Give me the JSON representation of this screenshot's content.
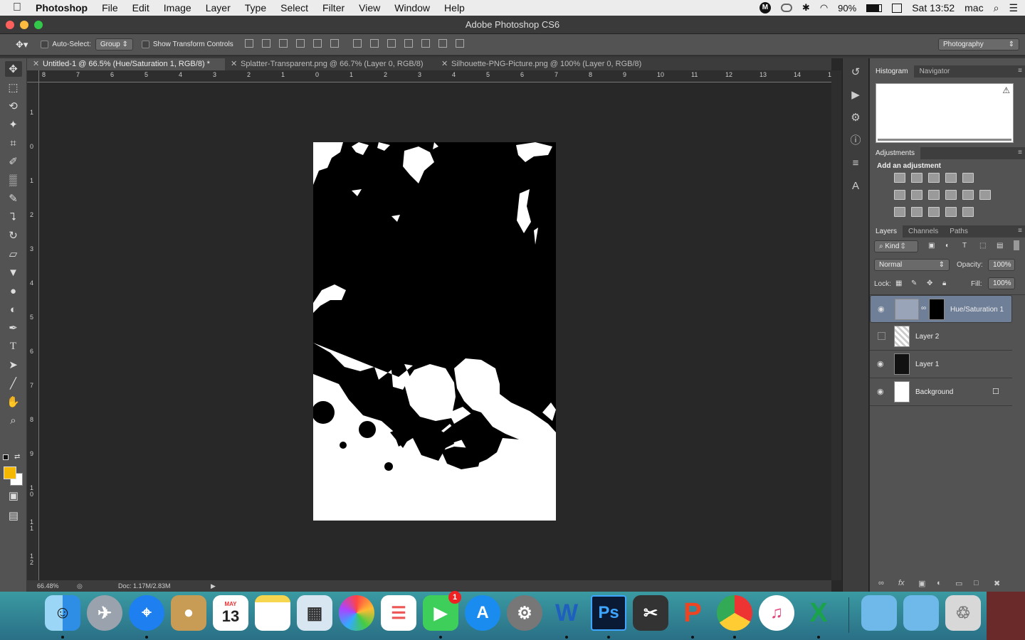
{
  "menubar": {
    "app_name": "Photoshop",
    "items": [
      "File",
      "Edit",
      "Image",
      "Layer",
      "Type",
      "Select",
      "Filter",
      "View",
      "Window",
      "Help"
    ],
    "battery": "90%",
    "clock": "Sat 13:52",
    "user": "mac"
  },
  "window": {
    "title": "Adobe Photoshop CS6"
  },
  "options": {
    "auto_select_label": "Auto-Select:",
    "auto_select_value": "Group",
    "show_transform_label": "Show Transform Controls",
    "workspace": "Photography"
  },
  "tabs": [
    {
      "label": "Untitled-1 @ 66.5% (Hue/Saturation 1, RGB/8) *"
    },
    {
      "label": "Splatter-Transparent.png @ 66.7% (Layer 0, RGB/8)"
    },
    {
      "label": "Silhouette-PNG-Picture.png @ 100% (Layer 0, RGB/8)"
    }
  ],
  "hruler_labels": [
    "8",
    "7",
    "6",
    "5",
    "4",
    "3",
    "2",
    "1",
    "0",
    "1",
    "2",
    "3",
    "4",
    "5",
    "6",
    "7",
    "8",
    "9",
    "10",
    "11",
    "12",
    "13",
    "14",
    "1"
  ],
  "vruler_labels": [
    "1",
    "0",
    "1",
    "2",
    "3",
    "4",
    "5",
    "6",
    "7",
    "8",
    "9",
    "1 0",
    "1 1",
    "1 2"
  ],
  "status": {
    "zoom": "66.48%",
    "doc": "Doc: 1.17M/2.83M"
  },
  "panels": {
    "histogram_tabs": [
      "Histogram",
      "Navigator"
    ],
    "adjustments_tab": "Adjustments",
    "adjustments_title": "Add an adjustment",
    "layers_tabs": [
      "Layers",
      "Channels",
      "Paths"
    ],
    "kind": "Kind",
    "blend_mode": "Normal",
    "opacity_label": "Opacity:",
    "opacity_value": "100%",
    "lock_label": "Lock:",
    "fill_label": "Fill:",
    "fill_value": "100%",
    "layers": [
      {
        "name": "Hue/Saturation 1",
        "visible": true,
        "selected": true
      },
      {
        "name": "Layer 2",
        "visible": false,
        "selected": false
      },
      {
        "name": "Layer 1",
        "visible": true,
        "selected": false
      },
      {
        "name": "Background",
        "visible": true,
        "selected": false
      }
    ]
  },
  "dock": {
    "calendar_month": "MAY",
    "calendar_day": "13",
    "facetime_badge": "1"
  },
  "colors": {
    "foreground": "#f5b800",
    "background": "#ffffff",
    "selected_layer": "#6f7f98"
  }
}
